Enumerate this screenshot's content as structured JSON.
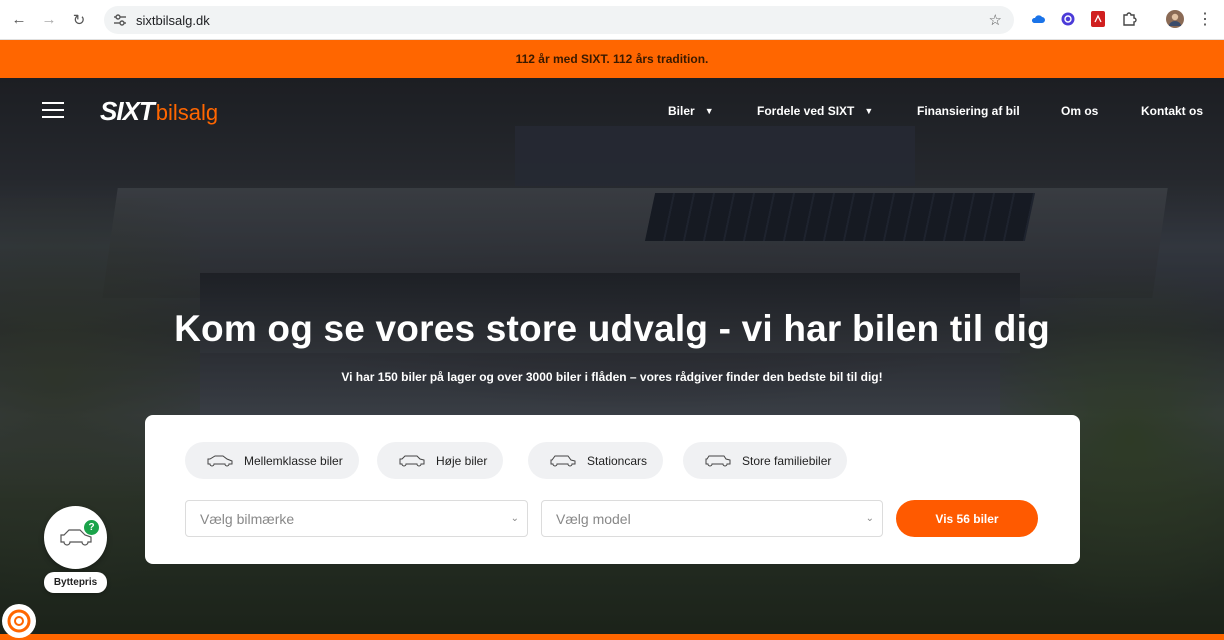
{
  "browser": {
    "url": "sixtbilsalg.dk",
    "icons": [
      "back-icon",
      "forward-icon",
      "reload-icon",
      "site-settings-icon",
      "bookmark-star-icon",
      "cloud-icon",
      "extension-icon",
      "pdf-icon",
      "puzzle-icon",
      "profile-avatar",
      "menu-kebab-icon"
    ]
  },
  "promo": {
    "text": "112 år med SIXT. 112 års tradition."
  },
  "header": {
    "logo_sixt": "SIXT",
    "logo_bilsalg": "bilsalg",
    "nav": {
      "biler": "Biler",
      "fordele": "Fordele ved SIXT",
      "finansiering": "Finansiering af bil",
      "om": "Om os",
      "kontakt": "Kontakt os"
    }
  },
  "hero": {
    "title": "Kom og se vores store udvalg - vi har bilen til dig",
    "subtitle": "Vi har 150 biler på lager og over 3000 biler i flåden  – vores rådgiver finder den bedste bil til dig!"
  },
  "search": {
    "chips": {
      "mellemklasse": "Mellemklasse biler",
      "hoje": "Høje biler",
      "stationcars": "Stationcars",
      "familie": "Store familiebiler"
    },
    "brand_placeholder": "Vælg bilmærke",
    "model_placeholder": "Vælg model",
    "cta": "Vis 56 biler"
  },
  "widgets": {
    "trade_label": "Byttepris"
  },
  "colors": {
    "accent": "#ff6600",
    "cta": "#ff5a00",
    "badge": "#1aa34a"
  }
}
